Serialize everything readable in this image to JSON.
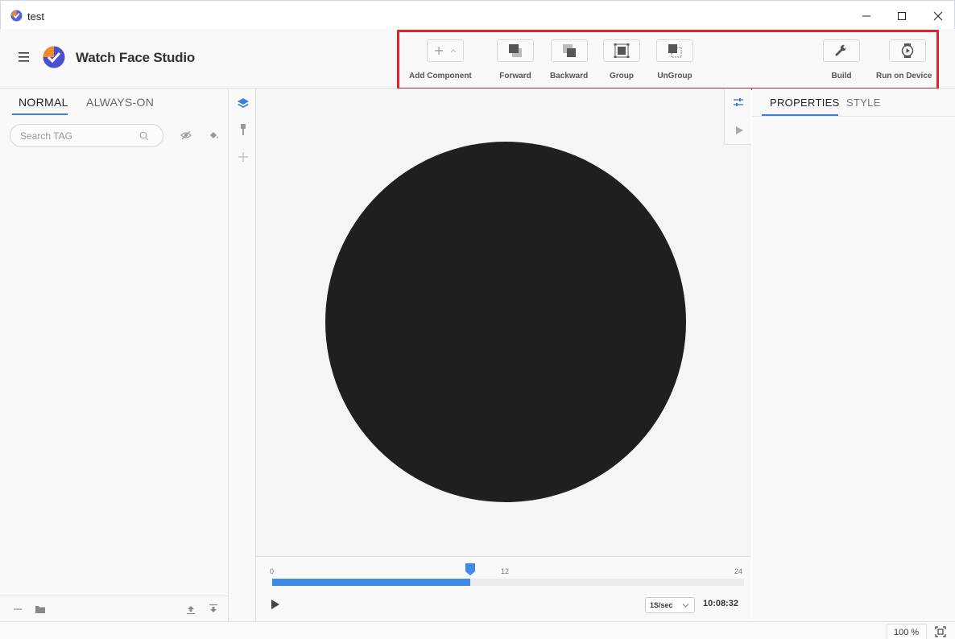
{
  "window": {
    "title": "test"
  },
  "header": {
    "app_name": "Watch Face Studio"
  },
  "toolbar": {
    "add_component": "Add Component",
    "forward": "Forward",
    "backward": "Backward",
    "group": "Group",
    "ungroup": "UnGroup",
    "build": "Build",
    "run_on_device": "Run on Device",
    "highlight_color": "#e8202a"
  },
  "left_panel": {
    "tabs": [
      {
        "label": "NORMAL"
      },
      {
        "label": "ALWAYS-ON"
      }
    ],
    "active_tab": "NORMAL",
    "search": {
      "placeholder": "Search TAG",
      "value": ""
    }
  },
  "right_panel": {
    "tabs": [
      {
        "label": "PROPERTIES"
      },
      {
        "label": "STYLE"
      }
    ],
    "active_tab": "PROPERTIES"
  },
  "timeline": {
    "start_label": "0",
    "mid_label": "12",
    "end_label": "24",
    "progress_fraction": 0.42,
    "speed": "1S/sec",
    "time": "10:08:32"
  },
  "status": {
    "zoom": "100 %"
  },
  "colors": {
    "accent": "#3c7fd6",
    "watch_face": "#1f1f1f",
    "timeline_fill": "#3f8ae6"
  }
}
